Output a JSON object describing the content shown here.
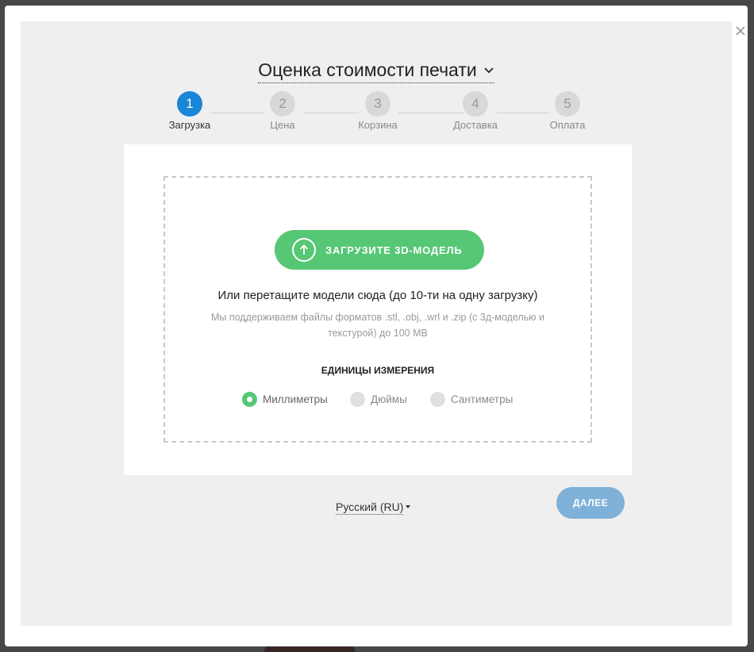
{
  "header": {
    "title": "Оценка стоимости печати"
  },
  "stepper": {
    "steps": [
      {
        "number": "1",
        "label": "Загрузка",
        "active": true
      },
      {
        "number": "2",
        "label": "Цена",
        "active": false
      },
      {
        "number": "3",
        "label": "Корзина",
        "active": false
      },
      {
        "number": "4",
        "label": "Доставка",
        "active": false
      },
      {
        "number": "5",
        "label": "Оплата",
        "active": false
      }
    ]
  },
  "upload": {
    "button_label": "ЗАГРУЗИТЕ 3D-МОДЕЛЬ",
    "drag_text": "Или перетащите модели сюда (до 10-ти на одну загрузку)",
    "support_text": "Мы поддерживаем файлы форматов .stl, .obj, .wrl и .zip (с 3д-моделью и текстурой) до 100 MB"
  },
  "units": {
    "title": "ЕДИНИЦЫ ИЗМЕРЕНИЯ",
    "options": [
      {
        "label": "Миллиметры",
        "checked": true
      },
      {
        "label": "Дюймы",
        "checked": false
      },
      {
        "label": "Сантиметры",
        "checked": false
      }
    ]
  },
  "footer": {
    "language": "Русский (RU)",
    "next_label": "ДАЛЕЕ"
  },
  "colors": {
    "accent_green": "#56c774",
    "active_step_blue": "#1b85d8",
    "next_button": "#7fb1d8"
  },
  "icons": [
    "close-icon",
    "chevron-down-icon",
    "upload-arrow-icon",
    "caret-down-icon"
  ]
}
